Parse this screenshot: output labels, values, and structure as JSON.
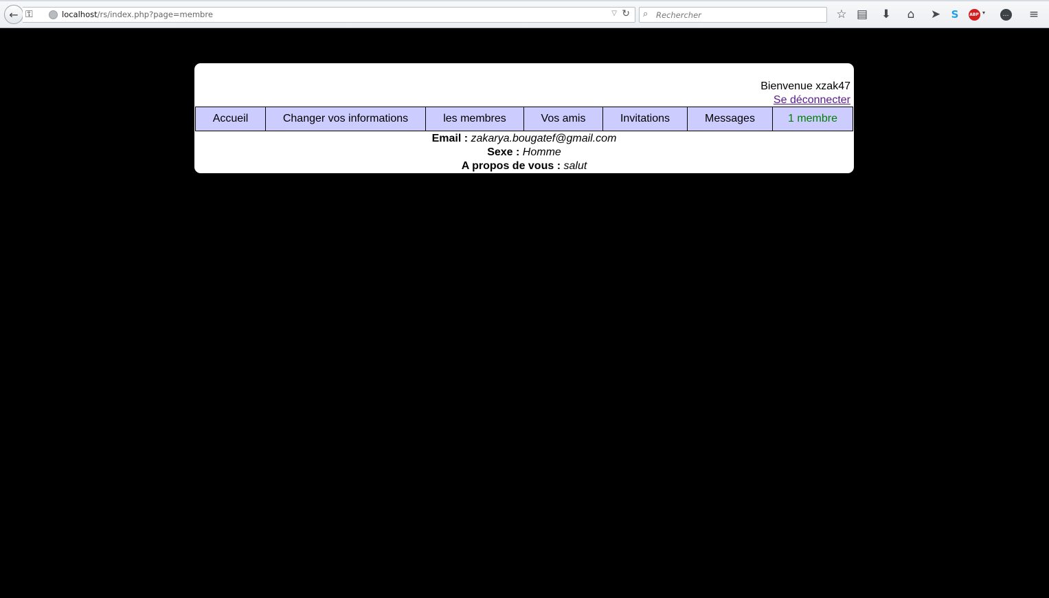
{
  "browser": {
    "url_host": "localhost",
    "url_path": "/rs/index.php?page=membre",
    "search_placeholder": "Rechercher",
    "toolbar_icons": [
      "bookmark-star-icon",
      "reading-list-icon",
      "download-icon",
      "home-icon",
      "send-icon",
      "skype-icon",
      "adblock-plus-icon",
      "chat-icon",
      "menu-icon"
    ],
    "abp_label": "ABP"
  },
  "header": {
    "welcome": "Bienvenue xzak47",
    "logout": "Se déconnecter"
  },
  "nav": {
    "items": [
      {
        "label": "Accueil"
      },
      {
        "label": "Changer vos informations"
      },
      {
        "label": "les membres"
      },
      {
        "label": "Vos amis"
      },
      {
        "label": "Invitations"
      },
      {
        "label": "Messages"
      },
      {
        "label": "1 membre",
        "color": "#008000"
      }
    ]
  },
  "profile": {
    "email_label": "Email :",
    "email_value": "zakarya.bougatef@gmail.com",
    "sex_label": "Sexe :",
    "sex_value": "Homme",
    "about_label": "A propos de vous :",
    "about_value": "salut"
  },
  "colors": {
    "page_background": "#000000",
    "panel_background": "#ffffff",
    "nav_background": "#ccccff",
    "link_visited": "#551a8b",
    "online_count": "#008000"
  }
}
